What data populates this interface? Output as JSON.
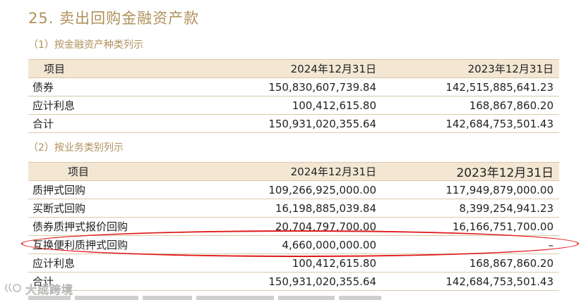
{
  "title": "25. 卖出回购金融资产款",
  "section1": {
    "subtitle": "（1）按金融资产种类列示",
    "headers": [
      "项目",
      "2024年12月31日",
      "2023年12月31日"
    ],
    "rows": [
      [
        "债券",
        "150,830,607,739.84",
        "142,515,885,641.23"
      ],
      [
        "应计利息",
        "100,412,615.80",
        "168,867,860.20"
      ],
      [
        "合计",
        "150,931,020,355.64",
        "142,684,753,501.43"
      ]
    ]
  },
  "section2": {
    "subtitle": "（2）按业务类别列示",
    "headers": [
      "项目",
      "2024年12月31日",
      "2023年12月31日"
    ],
    "rows": [
      [
        "质押式回购",
        "109,266,925,000.00",
        "117,949,879,000.00"
      ],
      [
        "买断式回购",
        "16,198,885,039.84",
        "8,399,254,941.23"
      ],
      [
        "债券质押式报价回购",
        "20,704,797,700.00",
        "16,166,751,700.00"
      ],
      [
        "互换便利质押式回购",
        "4,660,000,000.00",
        "–"
      ],
      [
        "应计利息",
        "100,412,615.80",
        "168,867,860.20"
      ],
      [
        "合计",
        "150,931,020,355.64",
        "142,684,753,501.43"
      ]
    ]
  },
  "watermark": "大成跨境",
  "colors": {
    "accent": "#b0905a",
    "header_bg": "#f3e7d3",
    "highlight": "#e01818"
  }
}
